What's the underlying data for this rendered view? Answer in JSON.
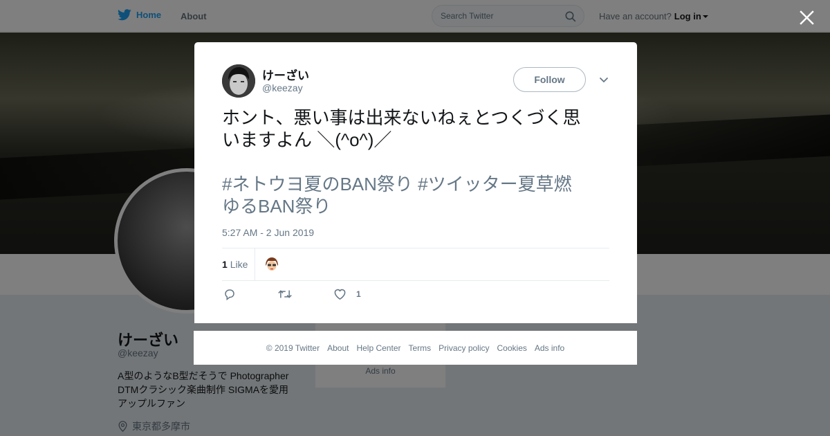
{
  "nav": {
    "home_label": "Home",
    "about_label": "About",
    "search_placeholder": "Search Twitter",
    "account_prompt": "Have an account?",
    "login_label": "Log in"
  },
  "profile": {
    "name": "けーざい",
    "handle": "@keezay",
    "bio": "A型のようなB型だそうで Photographer\nDTMクラシック楽曲制作 SIGMAを愛用\nアップルファン",
    "location": "東京都多摩市",
    "side_ads_label": "Ads info"
  },
  "tweet": {
    "display_name": "けーざい",
    "handle": "@keezay",
    "follow_label": "Follow",
    "text": "ホント、悪い事は出来ないねぇとつくづく思\nいますよん ＼(^o^)／",
    "hashtags": "#ネトウヨ夏のBAN祭り #ツイッター夏草燃\nゆるBAN祭り",
    "timestamp": "5:27 AM - 2 Jun 2019",
    "like_count": "1",
    "like_label": "Like",
    "action_like_count": "1"
  },
  "footer": {
    "links": [
      "© 2019 Twitter",
      "About",
      "Help Center",
      "Terms",
      "Privacy policy",
      "Cookies",
      "Ads info"
    ]
  },
  "colors": {
    "brand": "#1da1f2",
    "secondary_text": "#657786",
    "overlay": "rgba(0,0,0,0.5)"
  },
  "icons": {
    "logo": "twitter-bird-icon",
    "search": "search-icon",
    "close": "close-icon",
    "more": "chevron-down-icon",
    "reply": "reply-icon",
    "retweet": "retweet-icon",
    "like": "heart-icon",
    "location": "location-pin-icon"
  }
}
